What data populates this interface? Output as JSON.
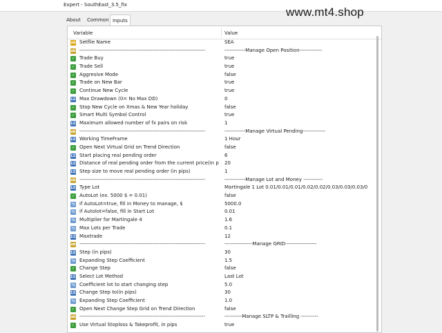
{
  "window": {
    "title": "Expert - SouthEast_3.5_fix"
  },
  "watermark": "www.mt4.shop",
  "tabs": [
    "About",
    "Common",
    "Inputs"
  ],
  "table": {
    "headers": {
      "variable": "Variable",
      "value": "Value"
    },
    "rows": [
      {
        "icon": "set",
        "name": "Setfile Name",
        "value": "SEA"
      },
      {
        "icon": "str",
        "name": "------------------------------------------------------------------------",
        "value": "------------Manage Open Position-------------"
      },
      {
        "icon": "bool",
        "name": "Trade Buy",
        "value": "true"
      },
      {
        "icon": "bool",
        "name": "Trade Sell",
        "value": "true"
      },
      {
        "icon": "bool",
        "name": "Aggresive Mode",
        "value": "false"
      },
      {
        "icon": "bool",
        "name": "Trade on New Bar",
        "value": "true"
      },
      {
        "icon": "bool",
        "name": "Continue New Cycle",
        "value": "true"
      },
      {
        "icon": "int",
        "name": "Max Drawdown (0= No Max DD)",
        "value": "0"
      },
      {
        "icon": "bool",
        "name": "Stop New Cycle on Xmas & New Year holiday",
        "value": "false"
      },
      {
        "icon": "bool",
        "name": "Smart Multi Symbol Control",
        "value": "true"
      },
      {
        "icon": "int",
        "name": "Maximum allowed number of fx pairs on risk",
        "value": "1"
      },
      {
        "icon": "str",
        "name": "------------------------------------------------------------------------",
        "value": "------------Manage Virtual Pending-------------"
      },
      {
        "icon": "int",
        "name": "Working TimeFrame",
        "value": "1 Hour"
      },
      {
        "icon": "bool",
        "name": "Open Next Virtual Grid on Trend Direction",
        "value": "false"
      },
      {
        "icon": "int",
        "name": "Start placing real pending order",
        "value": "6"
      },
      {
        "icon": "int",
        "name": "Distance of real pending order from the current price(in pips)",
        "value": "20"
      },
      {
        "icon": "int",
        "name": "Step size to move real pending order (in pips)",
        "value": "1"
      },
      {
        "icon": "str",
        "name": "------------------------------------------------------------------------",
        "value": "------------Manage Lot and Money -----------"
      },
      {
        "icon": "int",
        "name": "Type Lot",
        "value": "Martingale 1 Lot 0.01/0.01/0.01/0.02/0.02/0.03/0.03/0.03/0"
      },
      {
        "icon": "bool",
        "name": "AutoLot (ex. 5000 $ = 0.01)",
        "value": "false"
      },
      {
        "icon": "dbl",
        "name": "if AutoLot=true, fill in Money to manage, $",
        "value": "5000.0"
      },
      {
        "icon": "dbl",
        "name": "if Autolot=false, fill in Start Lot",
        "value": "0.01"
      },
      {
        "icon": "dbl",
        "name": "Multiplier for Martingale 4",
        "value": "1.6"
      },
      {
        "icon": "dbl",
        "name": "Max Lots per Trade",
        "value": "0.1"
      },
      {
        "icon": "int",
        "name": "Maxtrade",
        "value": "12"
      },
      {
        "icon": "str",
        "name": "------------------------------------------------------------------------",
        "value": "----------------Manage GRID------------------"
      },
      {
        "icon": "int",
        "name": "Step (in pips)",
        "value": "30"
      },
      {
        "icon": "dbl",
        "name": "Expanding Step Coefficient",
        "value": "1.5"
      },
      {
        "icon": "bool",
        "name": "Change Step",
        "value": "false"
      },
      {
        "icon": "int",
        "name": "Select Lot Method",
        "value": "Last Lot"
      },
      {
        "icon": "dbl",
        "name": "Coefficient lot to start changing step",
        "value": "5.0"
      },
      {
        "icon": "int",
        "name": "Change Step to(in pips)",
        "value": "30"
      },
      {
        "icon": "dbl",
        "name": "Expanding Step Coefficient",
        "value": "1.0"
      },
      {
        "icon": "bool",
        "name": "Open Next Change Step Grid on Trend Direction",
        "value": "false"
      },
      {
        "icon": "str",
        "name": "------------------------------------------------------------------------",
        "value": "----------Manage SLTP & Trailling ----------"
      },
      {
        "icon": "bool",
        "name": "Use Virtual Stoploss & Takeprofit, in pips",
        "value": "true"
      }
    ]
  }
}
